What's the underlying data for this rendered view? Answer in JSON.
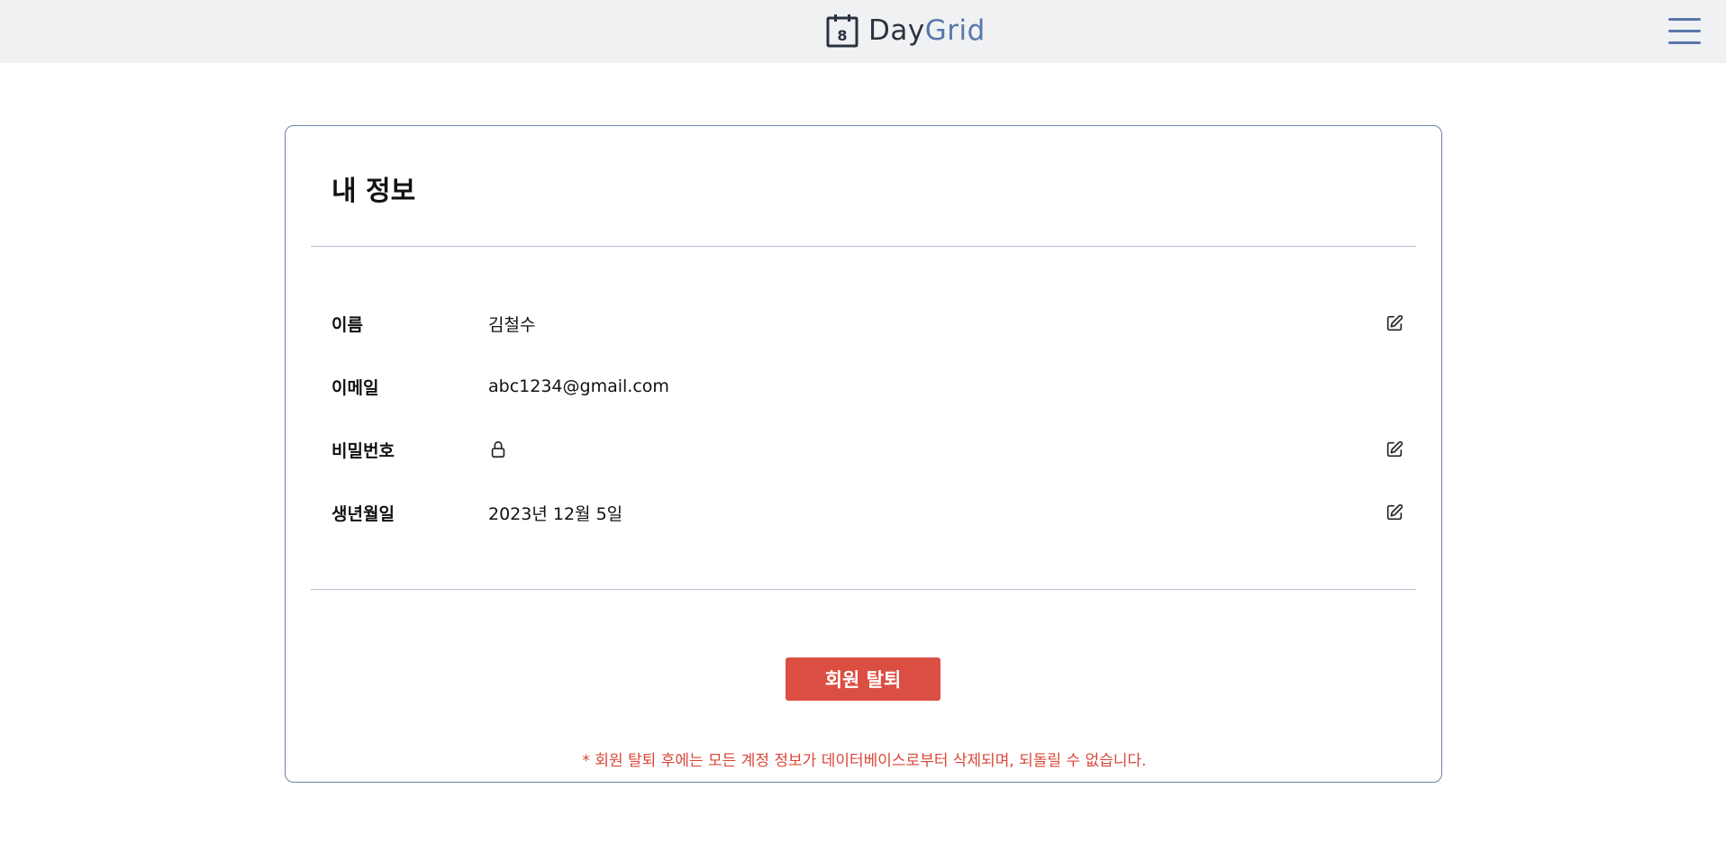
{
  "header": {
    "logo_number": "8",
    "logo_text_primary": "Day",
    "logo_text_secondary": "Grid",
    "menu_icon": "hamburger-menu-icon"
  },
  "profile": {
    "title": "내 정보",
    "fields": [
      {
        "label": "이름",
        "value": "김철수",
        "editable": true
      },
      {
        "label": "이메일",
        "value": "abc1234@gmail.com",
        "editable": false
      },
      {
        "label": "비밀번호",
        "value_icon": "lock-icon",
        "editable": true
      },
      {
        "label": "생년월일",
        "value": "2023년 12월 5일",
        "editable": true
      }
    ],
    "edit_icon": "edit-icon"
  },
  "withdraw": {
    "button_label": "회원 탈퇴",
    "warning": "* 회원 탈퇴 후에는 모든 계정 정보가 데이터베이스로부터 삭제되며, 되돌릴 수 없습니다."
  },
  "colors": {
    "header_bg": "#f0f1f3",
    "brand_dark": "#2b3240",
    "brand_accent": "#5877aa",
    "danger": "#db4f42",
    "card_border": "#6f83a8"
  }
}
